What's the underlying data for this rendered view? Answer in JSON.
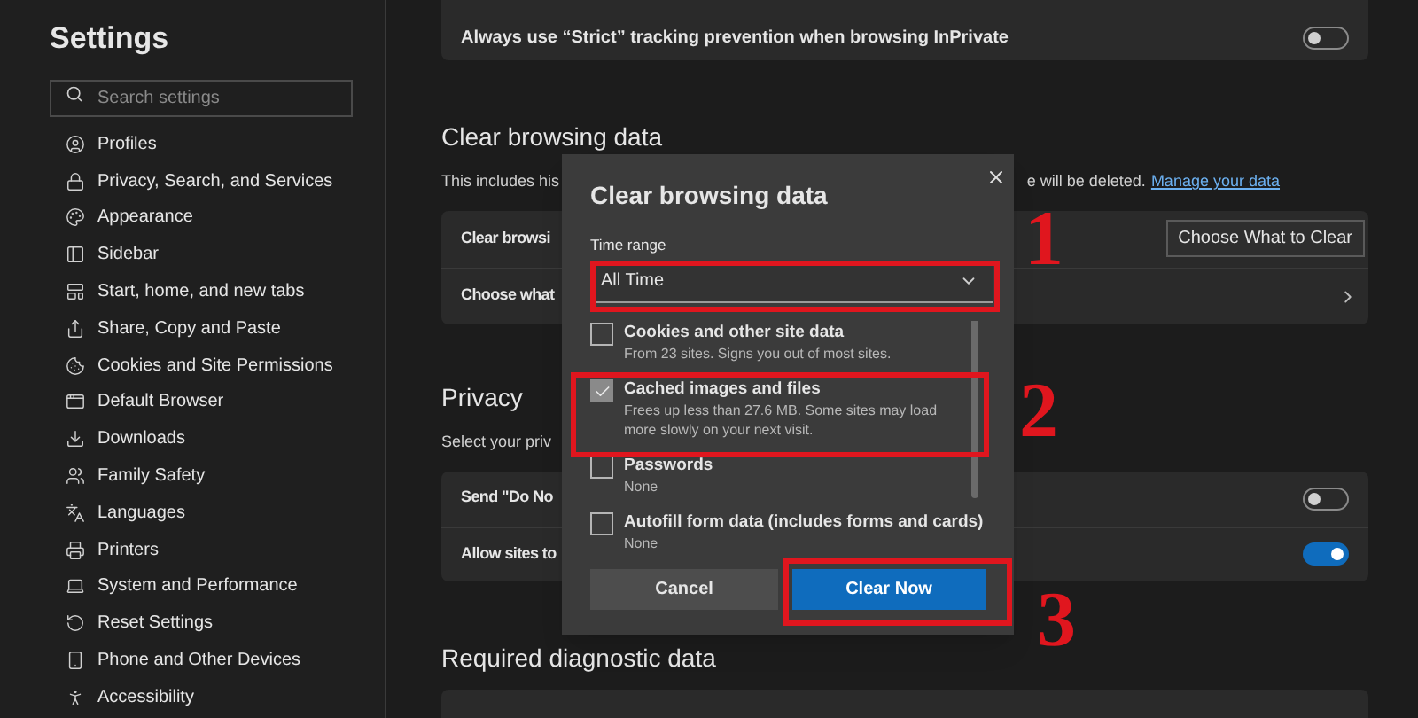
{
  "sidebar": {
    "title": "Settings",
    "search": {
      "placeholder": "Search settings"
    },
    "items": [
      {
        "label": "Profiles"
      },
      {
        "label": "Privacy, Search, and Services"
      },
      {
        "label": "Appearance"
      },
      {
        "label": "Sidebar"
      },
      {
        "label": "Start, home, and new tabs"
      },
      {
        "label": "Share, Copy and Paste"
      },
      {
        "label": "Cookies and Site Permissions"
      },
      {
        "label": "Default Browser"
      },
      {
        "label": "Downloads"
      },
      {
        "label": "Family Safety"
      },
      {
        "label": "Languages"
      },
      {
        "label": "Printers"
      },
      {
        "label": "System and Performance"
      },
      {
        "label": "Reset Settings"
      },
      {
        "label": "Phone and Other Devices"
      },
      {
        "label": "Accessibility"
      }
    ]
  },
  "top_card": {
    "label": "Always use “Strict” tracking prevention when browsing InPrivate",
    "on": false
  },
  "clear_browsing": {
    "heading": "Clear browsing data",
    "description_start": "This includes his",
    "description_end": "e will be deleted.",
    "link": "Manage your data",
    "rows": [
      {
        "kind": "button",
        "label": "Clear browsi",
        "button": "Choose What to Clear"
      },
      {
        "kind": "chevron",
        "label": "Choose what"
      }
    ]
  },
  "privacy": {
    "heading": "Privacy",
    "description": "Select your priv",
    "rows": [
      {
        "kind": "toggle",
        "label": "Send \"Do No",
        "on": false
      },
      {
        "kind": "toggle",
        "label": "Allow sites to",
        "on": true
      }
    ]
  },
  "diagnostic": {
    "heading": "Required diagnostic data"
  },
  "dialog": {
    "title": "Clear browsing data",
    "time_range_label": "Time range",
    "time_range": "All Time",
    "options": [
      {
        "label": "Cookies and other site data",
        "detail": "From 23 sites. Signs you out of most sites.",
        "checked": false
      },
      {
        "label": "Cached images and files",
        "detail": "Frees up less than 27.6 MB. Some sites may load more slowly on your next visit.",
        "checked": true
      },
      {
        "label": "Passwords",
        "detail": "None",
        "checked": false
      },
      {
        "label": "Autofill form data (includes forms and cards)",
        "detail": "None",
        "checked": false
      }
    ],
    "cancel": "Cancel",
    "confirm": "Clear Now"
  },
  "annotations": [
    {
      "label": "1"
    },
    {
      "label": "2"
    },
    {
      "label": "3"
    }
  ]
}
